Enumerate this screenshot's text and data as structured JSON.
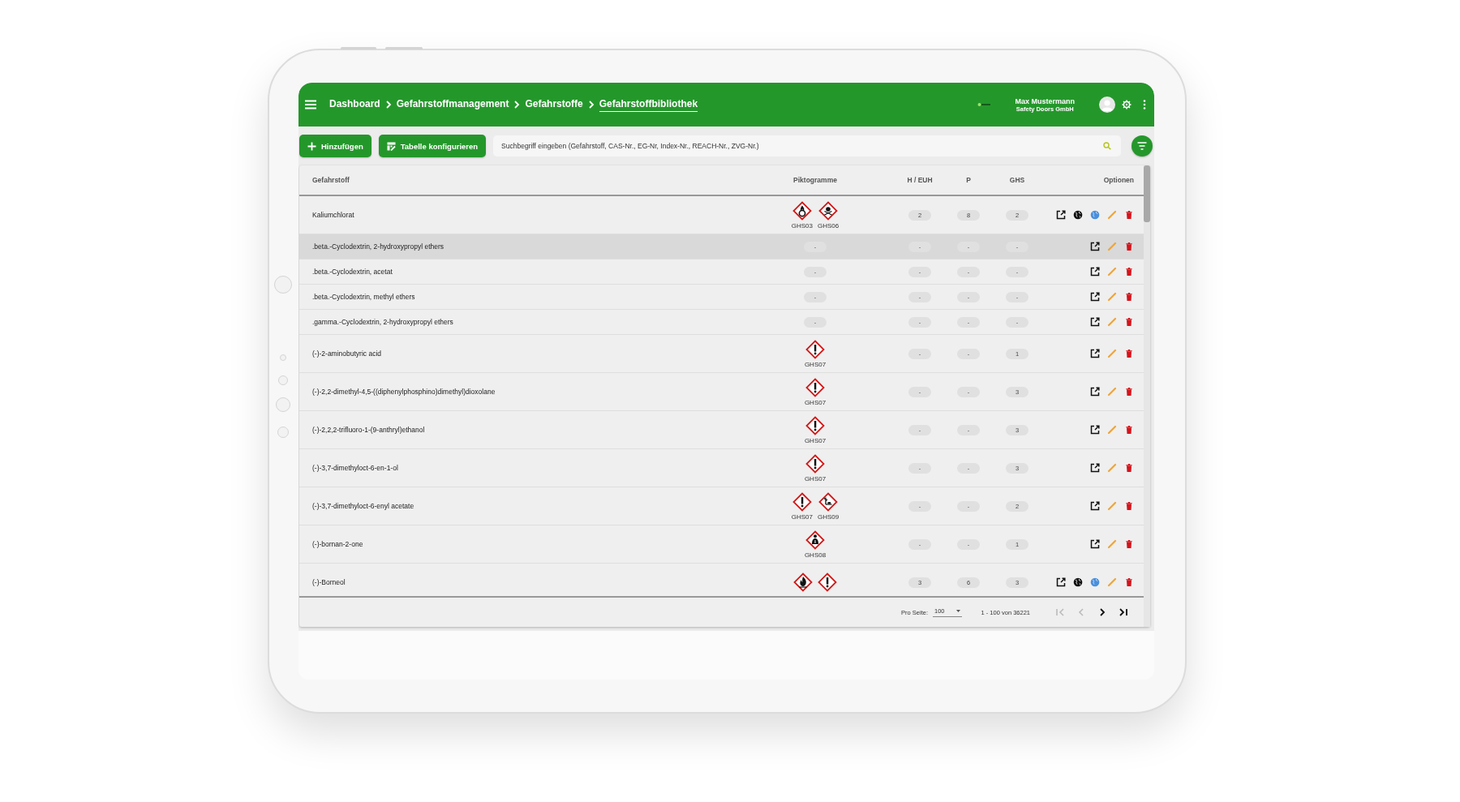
{
  "header": {
    "breadcrumbs": [
      {
        "label": "Dashboard",
        "current": false
      },
      {
        "label": "Gefahrstoffmanagement",
        "current": false
      },
      {
        "label": "Gefahrstoffe",
        "current": false
      },
      {
        "label": "Gefahrstoffbibliothek",
        "current": true
      }
    ],
    "user": {
      "name": "Max Mustermann",
      "company": "Safety Doors GmbH"
    }
  },
  "toolbar": {
    "buttons": [
      {
        "kind": "add",
        "label": "Hinzufügen"
      },
      {
        "kind": "configure",
        "label": "Tabelle konfigurieren"
      }
    ],
    "search": {
      "placeholder": "Suchbegriff eingeben (Gefahrstoff, CAS-Nr., EG-Nr, Index-Nr., REACH-Nr., ZVG-Nr.)"
    }
  },
  "table": {
    "columns": [
      "Gefahrstoff",
      "Piktogramme",
      "H / EUH",
      "P",
      "GHS",
      "Optionen"
    ],
    "rows": [
      {
        "name": "Kaliumchlorat",
        "selected": false,
        "pictograms": [
          {
            "kind": "flame_over_circle",
            "code": "GHS03"
          },
          {
            "kind": "skull",
            "code": "GHS06"
          }
        ],
        "h": "2",
        "p": "8",
        "ghs": "2",
        "actions": [
          {
            "kind": "open"
          },
          {
            "kind": "globe"
          },
          {
            "kind": "web"
          },
          {
            "kind": "edit"
          },
          {
            "kind": "delete"
          }
        ]
      },
      {
        "name": ".beta.-Cyclodextrin, 2-hydroxypropyl ethers",
        "selected": true,
        "pictograms": [
          {
            "kind": "none",
            "code": "-"
          }
        ],
        "h": "-",
        "p": "-",
        "ghs": "-",
        "actions": [
          {
            "kind": "open"
          },
          {
            "kind": "edit"
          },
          {
            "kind": "delete"
          }
        ]
      },
      {
        "name": ".beta.-Cyclodextrin, acetat",
        "selected": false,
        "pictograms": [
          {
            "kind": "none",
            "code": "-"
          }
        ],
        "h": "-",
        "p": "-",
        "ghs": "-",
        "actions": [
          {
            "kind": "open"
          },
          {
            "kind": "edit"
          },
          {
            "kind": "delete"
          }
        ]
      },
      {
        "name": ".beta.-Cyclodextrin, methyl ethers",
        "selected": false,
        "pictograms": [
          {
            "kind": "none",
            "code": "-"
          }
        ],
        "h": "-",
        "p": "-",
        "ghs": "-",
        "actions": [
          {
            "kind": "open"
          },
          {
            "kind": "edit"
          },
          {
            "kind": "delete"
          }
        ]
      },
      {
        "name": ".gamma.-Cyclodextrin, 2-hydroxypropyl ethers",
        "selected": false,
        "pictograms": [
          {
            "kind": "none",
            "code": "-"
          }
        ],
        "h": "-",
        "p": "-",
        "ghs": "-",
        "actions": [
          {
            "kind": "open"
          },
          {
            "kind": "edit"
          },
          {
            "kind": "delete"
          }
        ]
      },
      {
        "name": "(-)-2-aminobutyric acid",
        "selected": false,
        "pictograms": [
          {
            "kind": "exclamation",
            "code": "GHS07"
          }
        ],
        "h": "-",
        "p": "-",
        "ghs": "1",
        "actions": [
          {
            "kind": "open"
          },
          {
            "kind": "edit"
          },
          {
            "kind": "delete"
          }
        ]
      },
      {
        "name": "(-)-2,2-dimethyl-4,5-((diphenylphosphino)dimethyl)dioxolane",
        "selected": false,
        "pictograms": [
          {
            "kind": "exclamation",
            "code": "GHS07"
          }
        ],
        "h": "-",
        "p": "-",
        "ghs": "3",
        "actions": [
          {
            "kind": "open"
          },
          {
            "kind": "edit"
          },
          {
            "kind": "delete"
          }
        ]
      },
      {
        "name": "(-)-2,2,2-trifluoro-1-(9-anthryl)ethanol",
        "selected": false,
        "pictograms": [
          {
            "kind": "exclamation",
            "code": "GHS07"
          }
        ],
        "h": "-",
        "p": "-",
        "ghs": "3",
        "actions": [
          {
            "kind": "open"
          },
          {
            "kind": "edit"
          },
          {
            "kind": "delete"
          }
        ]
      },
      {
        "name": "(-)-3,7-dimethyloct-6-en-1-ol",
        "selected": false,
        "pictograms": [
          {
            "kind": "exclamation",
            "code": "GHS07"
          }
        ],
        "h": "-",
        "p": "-",
        "ghs": "3",
        "actions": [
          {
            "kind": "open"
          },
          {
            "kind": "edit"
          },
          {
            "kind": "delete"
          }
        ]
      },
      {
        "name": "(-)-3,7-dimethyloct-6-enyl acetate",
        "selected": false,
        "pictograms": [
          {
            "kind": "exclamation",
            "code": "GHS07"
          },
          {
            "kind": "environment",
            "code": "GHS09"
          }
        ],
        "h": "-",
        "p": "-",
        "ghs": "2",
        "actions": [
          {
            "kind": "open"
          },
          {
            "kind": "edit"
          },
          {
            "kind": "delete"
          }
        ]
      },
      {
        "name": "(-)-bornan-2-one",
        "selected": false,
        "pictograms": [
          {
            "kind": "health_hazard",
            "code": "GHS08"
          }
        ],
        "h": "-",
        "p": "-",
        "ghs": "1",
        "actions": [
          {
            "kind": "open"
          },
          {
            "kind": "edit"
          },
          {
            "kind": "delete"
          }
        ]
      },
      {
        "name": "(-)-Borneol",
        "selected": false,
        "pictograms": [
          {
            "kind": "flame"
          },
          {
            "kind": "exclamation"
          }
        ],
        "h": "3",
        "p": "6",
        "ghs": "3",
        "actions": [
          {
            "kind": "open"
          },
          {
            "kind": "globe"
          },
          {
            "kind": "web"
          },
          {
            "kind": "edit"
          },
          {
            "kind": "delete"
          }
        ]
      }
    ]
  },
  "pager": {
    "label": "Pro Seite:",
    "page_size": "100",
    "range": "1 - 100 von 36221",
    "buttons": [
      {
        "kind": "first",
        "disabled": true
      },
      {
        "kind": "prev",
        "disabled": true
      },
      {
        "kind": "next",
        "disabled": false
      },
      {
        "kind": "last",
        "disabled": false
      }
    ]
  }
}
